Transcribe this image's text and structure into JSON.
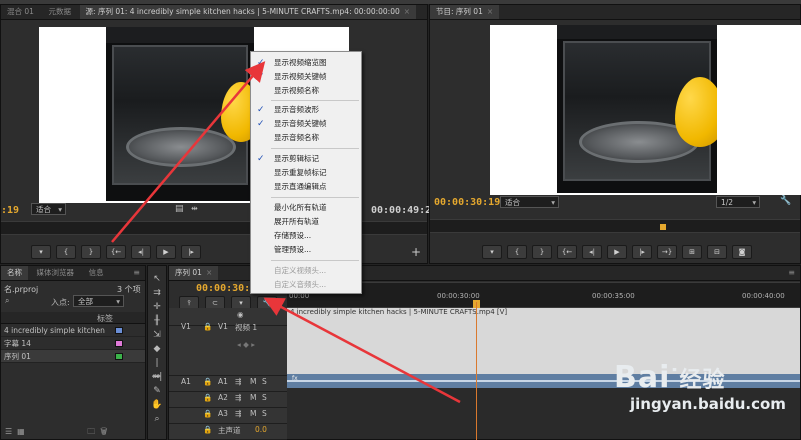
{
  "source_panel": {
    "tabs": [
      {
        "label": "混合 01"
      },
      {
        "label": "元数据"
      },
      {
        "label": "源: 序列 01: 4 incredibly simple kitchen hacks | 5-MINUTE CRAFTS.mp4: 00:00:00:00"
      }
    ],
    "timecode_left": ":19",
    "fit_label": "适合",
    "timecode_right": "00:00:49:24"
  },
  "program_panel": {
    "tab_label": "节目: 序列 01",
    "timecode_left": "00:00:30:19",
    "fit_label": "适合",
    "resolution": "1/2"
  },
  "context_menu": {
    "items": [
      {
        "label": "显示视频缩览图",
        "checked": true
      },
      {
        "label": "显示视频关键帧",
        "checked": true
      },
      {
        "label": "显示视频名称",
        "checked": false
      },
      {
        "label": "显示音频波形",
        "checked": true
      },
      {
        "label": "显示音频关键帧",
        "checked": true
      },
      {
        "label": "显示音频名称",
        "checked": false
      },
      {
        "label": "显示剪辑标记",
        "checked": true
      },
      {
        "label": "显示重复帧标记",
        "checked": false
      },
      {
        "label": "显示直通编辑点",
        "checked": false
      },
      {
        "label": "最小化所有轨道",
        "checked": false
      },
      {
        "label": "展开所有轨道",
        "checked": false
      },
      {
        "label": "存储预设...",
        "checked": false
      },
      {
        "label": "管理预设...",
        "checked": false
      },
      {
        "label": "自定义视频头...",
        "checked": false,
        "disabled": true
      },
      {
        "label": "自定义音频头...",
        "checked": false,
        "disabled": true
      }
    ],
    "check_glyph": "✓"
  },
  "project_panel": {
    "tabs": [
      {
        "label": "名称"
      },
      {
        "label": "媒体浏览器"
      },
      {
        "label": "信息"
      }
    ],
    "project_name": "名.prproj",
    "item_count": "3 个项",
    "in_point_label": "入点:",
    "in_point_value": "全部",
    "tag_header": "标签",
    "items": [
      {
        "name": "4 incredibly simple kitchen",
        "color": "#6b8fd6"
      },
      {
        "name": "字幕 14",
        "color": "#e07ad8"
      },
      {
        "name": "序列 01",
        "color": "#3bb24a"
      }
    ]
  },
  "timeline": {
    "tab_label": "序列 01",
    "timecode": "00:00:30:19",
    "ruler_labels": [
      "00:00",
      "00:00:30:00",
      "00:00:35:00",
      "00:00:40:00"
    ],
    "clip_name": "4 incredibly simple kitchen hacks | 5-MINUTE CRAFTS.mp4 [V]",
    "tracks": {
      "v1_src": "V1",
      "v1": "V1",
      "v1_name": "视频 1",
      "a1_src": "A1",
      "a1": "A1",
      "a2": "A2",
      "a3": "A3",
      "master": "主声道",
      "master_value": "0.0"
    },
    "track_buttons": {
      "mute": "M",
      "solo": "S"
    },
    "audio_clip_label": "fx"
  },
  "watermark": {
    "brand": "Bai",
    "brand_suffix": "经验",
    "url": "jingyan.baidu.com"
  },
  "colors": {
    "accent_timecode": "#e5a82e",
    "arrow": "#e8363a",
    "playhead": "#d9792e"
  }
}
